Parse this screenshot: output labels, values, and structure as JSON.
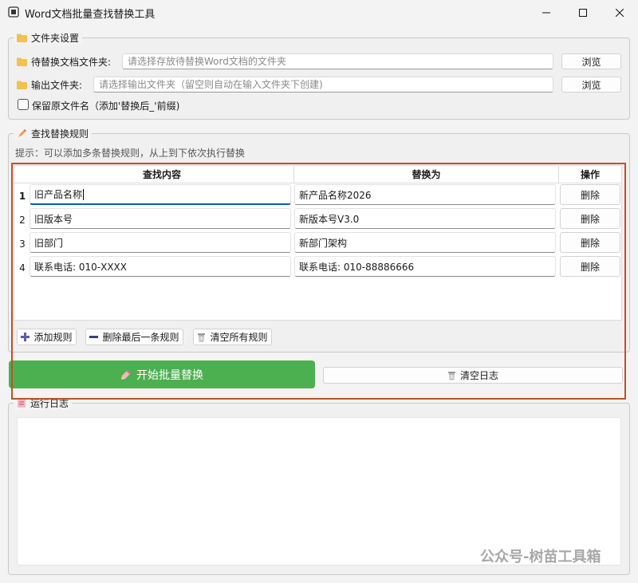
{
  "window": {
    "title": "Word文档批量查找替换工具"
  },
  "folder_settings": {
    "group_title": "文件夹设置",
    "source_label": "待替换文档文件夹:",
    "source_placeholder": "请选择存放待替换Word文档的文件夹",
    "output_label": "输出文件夹:",
    "output_placeholder": "请选择输出文件夹（留空则自动在输入文件夹下创建)",
    "browse_label": "浏览",
    "keep_name_label": "保留原文件名（添加'替换后_'前缀)",
    "keep_name_checked": false
  },
  "rules": {
    "group_title": "查找替换规则",
    "hint": "提示：可以添加多条替换规则，从上到下依次执行替换",
    "columns": [
      "查找内容",
      "替换为",
      "操作"
    ],
    "rows": [
      {
        "num": "1",
        "find": "旧产品名称",
        "replace": "新产品名称2026",
        "action": "删除"
      },
      {
        "num": "2",
        "find": "旧版本号",
        "replace": "新版本号V3.0",
        "action": "删除"
      },
      {
        "num": "3",
        "find": "旧部门",
        "replace": "新部门架构",
        "action": "删除"
      },
      {
        "num": "4",
        "find": "联系电话: 010-XXXX",
        "replace": "联系电话: 010-88886666",
        "action": "删除"
      }
    ],
    "add_label": "添加规则",
    "delete_last_label": "删除最后一条规则",
    "clear_all_label": "清空所有规则"
  },
  "actions": {
    "start_label": "开始批量替换",
    "clear_log_label": "清空日志"
  },
  "log": {
    "group_title": "运行日志"
  },
  "watermark": "公众号-树苗工具箱",
  "colors": {
    "start_green": "#4caf50",
    "highlight_border": "#c0502a",
    "folder_yellow": "#f2c14e"
  }
}
